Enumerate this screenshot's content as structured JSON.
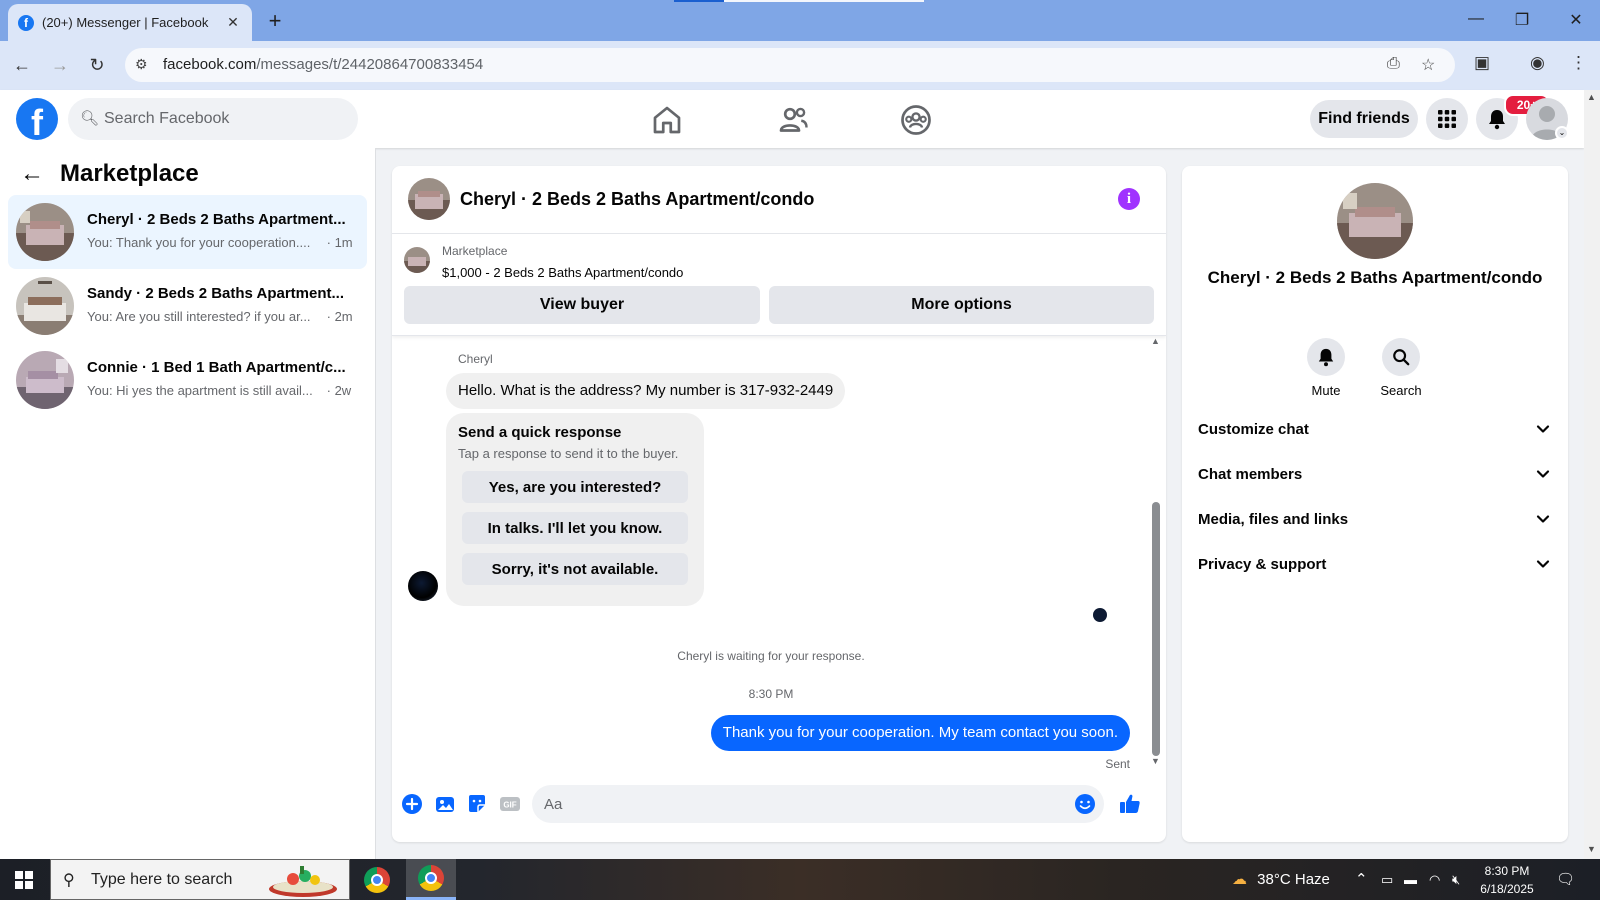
{
  "browser": {
    "tab_title": "(20+) Messenger | Facebook",
    "tab_favicon": "f",
    "close_tab": "✕",
    "new_tab": "+",
    "url_host": "facebook.com",
    "url_path": "/messages/t/24420864700833454"
  },
  "fb": {
    "search_placeholder": "Search Facebook",
    "find_friends": "Find friends",
    "notification_badge": "20+",
    "logo": "f",
    "colors": {
      "brand": "#1877f2",
      "sent_bubble": "#0866ff",
      "badge": "#e41e3f"
    }
  },
  "sidebar": {
    "title": "Marketplace",
    "conversations": [
      {
        "name": "Cheryl · 2 Beds 2 Baths Apartment...",
        "snippet": "You: Thank you for your cooperation....",
        "time": "· 1m",
        "active": true
      },
      {
        "name": "Sandy · 2 Beds 2 Baths Apartment...",
        "snippet": "You: Are you still interested? if you ar...",
        "time": "· 2m",
        "active": false
      },
      {
        "name": "Connie · 1 Bed 1 Bath Apartment/c...",
        "snippet": "You: Hi yes the apartment is still avail...",
        "time": "· 2w",
        "active": false
      }
    ]
  },
  "chat": {
    "title": "Cheryl · 2 Beds 2 Baths Apartment/condo",
    "listing_category": "Marketplace",
    "listing_price_title": "$1,000 - 2 Beds 2 Baths Apartment/condo",
    "view_buyer": "View buyer",
    "more_options": "More options",
    "sender_name": "Cheryl",
    "incoming_message": "Hello. What is the address? My number is 317-932-2449",
    "quick_title": "Send a quick response",
    "quick_subtitle": "Tap a response to send it to the buyer.",
    "quick_responses": [
      "Yes, are you interested?",
      "In talks. I'll let you know.",
      "Sorry, it's not available."
    ],
    "waiting_text": "Cheryl is waiting for your response.",
    "timestamp": "8:30 PM",
    "outgoing_message": "Thank you for your cooperation. My team contact you soon.",
    "status": "Sent",
    "composer_placeholder": "Aa"
  },
  "info_panel": {
    "name": "Cheryl · 2 Beds 2 Baths Apartment/condo",
    "actions": [
      {
        "label": "Mute",
        "icon": "bell-icon"
      },
      {
        "label": "Search",
        "icon": "search-icon"
      }
    ],
    "sections": [
      "Customize chat",
      "Chat members",
      "Media, files and links",
      "Privacy & support"
    ]
  },
  "taskbar": {
    "search_placeholder": "Type here to search",
    "weather": "38°C  Haze",
    "time": "8:30 PM",
    "date": "6/18/2025"
  }
}
